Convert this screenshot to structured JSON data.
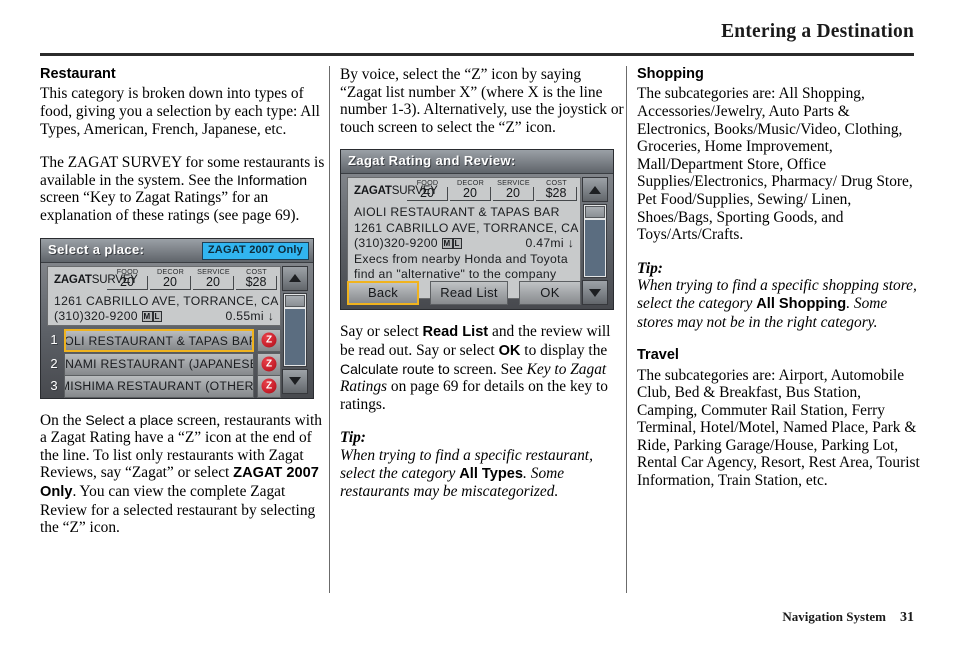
{
  "header": {
    "title": "Entering a Destination"
  },
  "footer": {
    "label": "Navigation System",
    "page_number": "31"
  },
  "columns": {
    "col1": {
      "heading": "Restaurant",
      "para1": "This category is broken down into types of food, giving you a selection by each type: All Types, American, French, Japanese, etc.",
      "para2_a": "The ZAGAT SURVEY for some restaurants is available in the system. See the ",
      "para2_sans": "Information",
      "para2_b": " screen “Key to Zagat Ratings” for an explanation of these ratings (see page 69).",
      "para3_a": "On the ",
      "para3_sans": "Select a place",
      "para3_b": " screen, restaurants with a Zagat Rating have a “Z” icon at the end of the line. To list only restaurants with Zagat Reviews, say “Zagat” or select ",
      "para3_bold": "ZAGAT 2007 Only",
      "para3_c": ". You can view the complete Zagat Review for a selected restaurant by selecting the “Z” icon."
    },
    "col2": {
      "para1": "By voice, select the “Z” icon by  saying “Zagat list number X” (where X is the line number 1-3). Alternatively, use the joystick or touch screen to select the “Z” icon.",
      "para2_a": "Say or select ",
      "para2_bold1": "Read List",
      "para2_b": " and the review will be read out. Say or select ",
      "para2_bold2": "OK",
      "para2_c": " to display the ",
      "para2_sans": "Calculate route to",
      "para2_d": " screen. See ",
      "para2_ital": "Key to Zagat Ratings",
      "para2_e": " on page 69 for details on the key to ratings.",
      "tip_label": "Tip:",
      "tip_a": "When trying to find a specific restaurant, select the category ",
      "tip_bold": "All Types",
      "tip_b": ". Some restaurants may be miscategorized."
    },
    "col3": {
      "heading1": "Shopping",
      "para1": "The subcategories are: All Shopping, Accessories/Jewelry, Auto Parts & Electronics, Books/Music/Video, Clothing, Groceries, Home Improvement, Mall/Department Store, Office Supplies/Electronics, Pharmacy/ Drug Store, Pet Food/Supplies, Sewing/ Linen, Shoes/Bags, Sporting Goods, and Toys/Arts/Crafts.",
      "tip_label": "Tip:",
      "tip_a": "When trying to find a specific shopping store, select the category ",
      "tip_bold": "All Shopping",
      "tip_b": ". Some stores may not be in the right category.",
      "heading2": "Travel",
      "para2": "The subcategories are: Airport, Automobile Club, Bed & Breakfast, Bus Station, Camping, Commuter Rail Station, Ferry Terminal, Hotel/Motel, Named Place, Park & Ride, Parking Garage/House, Parking Lot, Rental Car Agency, Resort, Rest Area, Tourist Information, Train Station, etc."
    }
  },
  "screenshot_select_place": {
    "title": "Select a place:",
    "badge": "ZAGAT 2007 Only",
    "survey_brand_bold": "ZAGAT",
    "survey_brand_light": "SURVEY",
    "ratings": [
      {
        "label": "FOOD",
        "value": "20"
      },
      {
        "label": "DECOR",
        "value": "20"
      },
      {
        "label": "SERVICE",
        "value": "20"
      },
      {
        "label": "COST",
        "value": "$28"
      }
    ],
    "address": "1261 CABRILLO AVE, TORRANCE, CA",
    "phone": "(310)320-9200",
    "flag1": "M",
    "flag2": "L",
    "distance": "0.55mi",
    "rows": [
      {
        "num": "1",
        "name": "AIOLI RESTAURANT & TAPAS BAR (",
        "z": "Z",
        "selected": true
      },
      {
        "num": "2",
        "name": "ONAMI RESTAURANT (JAPANESE)",
        "z": "Z",
        "selected": false
      },
      {
        "num": "3",
        "name": "MISHIMA RESTAURANT (OTHER)",
        "z": "Z",
        "selected": false
      }
    ]
  },
  "screenshot_zagat_review": {
    "title": "Zagat Rating and Review:",
    "survey_brand_bold": "ZAGAT",
    "survey_brand_light": "SURVEY",
    "ratings": [
      {
        "label": "FOOD",
        "value": "20"
      },
      {
        "label": "DECOR",
        "value": "20"
      },
      {
        "label": "SERVICE",
        "value": "20"
      },
      {
        "label": "COST",
        "value": "$28"
      }
    ],
    "name": "AIOLI RESTAURANT & TAPAS BAR",
    "address": "1261 CABRILLO AVE, TORRANCE, CA",
    "phone": "(310)320-9200",
    "flag1": "M",
    "flag2": "L",
    "distance": "0.47mi",
    "review_line1": "Execs from nearby Honda and Toyota",
    "review_line2": "find an \"alternative\" to the company",
    "buttons": [
      {
        "label": "Back",
        "selected": true
      },
      {
        "label": "Read List",
        "selected": false
      },
      {
        "label": "OK",
        "selected": false
      }
    ]
  },
  "colors": {
    "accent_selection": "#f0b31e",
    "badge_blue": "#31b5f0",
    "z_icon_red": "#c8202c"
  }
}
